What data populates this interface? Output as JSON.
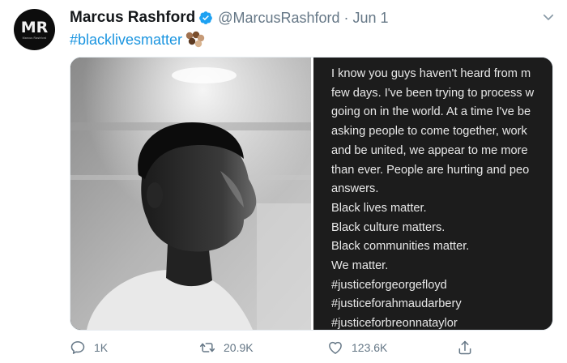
{
  "author": {
    "name": "Marcus Rashford",
    "handle": "@MarcusRashford",
    "separator": "·",
    "date": "Jun 1",
    "avatar_monogram": "MR",
    "avatar_subtext": "Marcus Rashford"
  },
  "tweet": {
    "hashtag": "#blacklivesmatter",
    "emoji_icon": "raised-fists-icon"
  },
  "media": {
    "photo_icon": "portrait-photo",
    "text_lines": [
      "I know you guys haven't heard from m",
      "few days. I've been trying to process w",
      "going on in the world. At a time I've be",
      "asking people to come together, work",
      "and be united, we appear to me more",
      "than ever. People are hurting and peo",
      "answers.",
      "Black lives matter.",
      "Black culture matters.",
      "Black communities matter.",
      "We matter.",
      "#justiceforgeorgefloyd",
      "#justiceforahmaudarbery",
      "#justiceforbreonnataylor"
    ]
  },
  "actions": {
    "replies": "1K",
    "retweets": "20.9K",
    "likes": "123.6K"
  },
  "colors": {
    "link": "#1b95e0",
    "verified": "#1da1f2",
    "muted": "#657786",
    "text": "#14171a",
    "panel_bg": "#1c1c1c"
  }
}
